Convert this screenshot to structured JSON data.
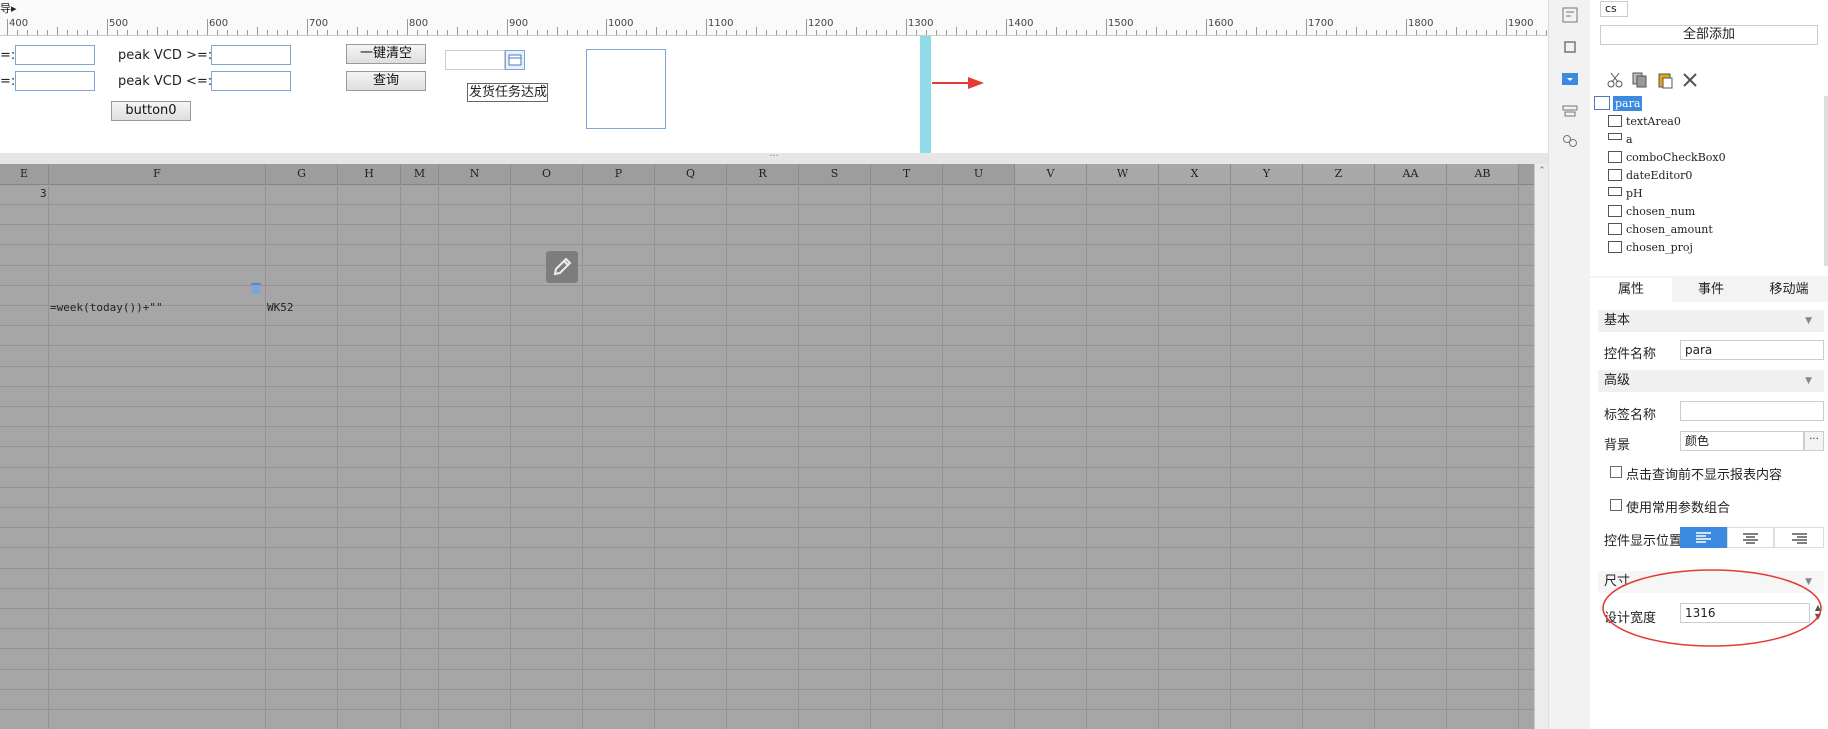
{
  "ruler": {
    "ticks": [
      "400",
      "500",
      "600",
      "700",
      "800",
      "900",
      "1000",
      "1100",
      "1200",
      "1300",
      "1400",
      "1500",
      "1600",
      "1700",
      "1800",
      "1900"
    ],
    "corner_label": "导▸"
  },
  "params": {
    "label_ge": "=:",
    "label_le": "=:",
    "peak_ge_label": "peak VCD >=:",
    "peak_le_label": "peak VCD <=:",
    "clear_button": "一键清空",
    "query_button": "查询",
    "button0": "button0",
    "task_label": "发货任务达成%",
    "grip": "···"
  },
  "sheet": {
    "columns": [
      "E",
      "F",
      "G",
      "H",
      "M",
      "N",
      "O",
      "P",
      "Q",
      "R",
      "S",
      "T",
      "U",
      "V",
      "W",
      "X",
      "Y",
      "Z",
      "AA",
      "AB"
    ],
    "cells": {
      "e1": "3",
      "f_formula": "=week(today())+\"\"",
      "g_value": "WK52"
    }
  },
  "right_panel": {
    "search_value": "cs",
    "add_all_button": "全部添加",
    "tree": [
      "para",
      "textArea0",
      "a",
      "comboCheckBox0",
      "dateEditor0",
      "pH",
      "chosen_num",
      "chosen_amount",
      "chosen_proj"
    ],
    "tabs": [
      "属性",
      "事件",
      "移动端"
    ],
    "sections": {
      "basic": "基本",
      "advanced": "高级",
      "size": "尺寸"
    },
    "props": {
      "widget_name_label": "控件名称",
      "widget_name_value": "para",
      "tag_name_label": "标签名称",
      "tag_name_value": "",
      "background_label": "背景",
      "background_value": "颜色",
      "background_more": "···",
      "no_show_before_query": "点击查询前不显示报表内容",
      "use_param_combo": "使用常用参数组合",
      "display_pos_label": "控件显示位置",
      "design_width_label": "设计宽度",
      "design_width_value": "1316"
    }
  },
  "colors": {
    "accent_blue": "#3c8ae0",
    "sheet_bg": "#a6a6a6",
    "annotation_red": "#e53935",
    "splitter_cyan": "#8fdce8"
  }
}
